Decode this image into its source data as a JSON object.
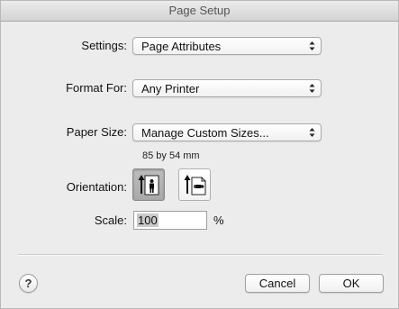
{
  "window": {
    "title": "Page Setup"
  },
  "settings": {
    "label": "Settings:",
    "value": "Page Attributes"
  },
  "format_for": {
    "label": "Format For:",
    "value": "Any Printer"
  },
  "paper_size": {
    "label": "Paper Size:",
    "value": "Manage Custom Sizes...",
    "dimensions": "85 by 54 mm"
  },
  "orientation": {
    "label": "Orientation:",
    "selected": "portrait",
    "options": [
      "portrait",
      "landscape"
    ]
  },
  "scale": {
    "label": "Scale:",
    "value": "100",
    "unit": "%"
  },
  "footer": {
    "help": "?",
    "cancel": "Cancel",
    "ok": "OK"
  },
  "icons": {
    "help": "question-mark-icon",
    "popup": "updown-arrows-icon",
    "portrait": "portrait-orientation-icon",
    "landscape": "landscape-orientation-icon"
  }
}
